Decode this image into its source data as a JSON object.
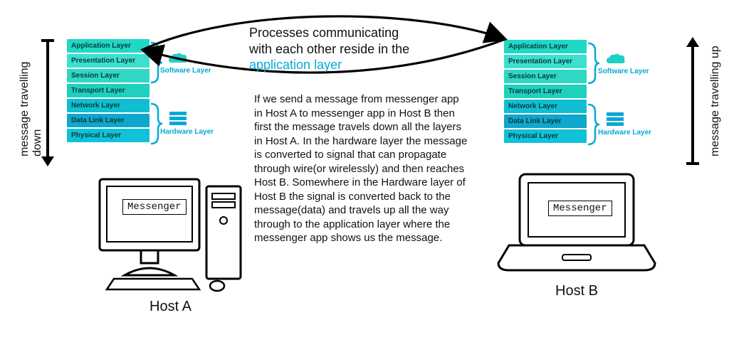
{
  "left_caption": "message travelling down",
  "right_caption": "message travelling up",
  "headline": {
    "line1": "Processes communicating",
    "line2": "with each other reside in the",
    "accent": "application layer"
  },
  "body": "If we send a message from messenger app in Host A to messenger app in Host B then first the message travels down all the layers in Host A. In the hardware layer the message is converted to signal that can propagate through wire(or wirelessly) and then reaches Host B. Somewhere in the Hardware layer of Host B the signal is converted back to the message(data) and travels up all the way through to the application layer where the messenger app shows us the message.",
  "layers": [
    "Application Layer",
    "Presentation Layer",
    "Session Layer",
    "Transport Layer",
    "Network Layer",
    "Data Link Layer",
    "Physical Layer"
  ],
  "layer_colors": [
    "#1fd9c6",
    "#3be0cf",
    "#2ed8c4",
    "#1fd0bd",
    "#0fbfd1",
    "#0fa7cb",
    "#0fc2d8"
  ],
  "annotations": {
    "software": "Software Layer",
    "hardware": "Hardware Layer"
  },
  "hosts": {
    "a": "Host A",
    "b": "Host B"
  },
  "app_label": "Messenger"
}
